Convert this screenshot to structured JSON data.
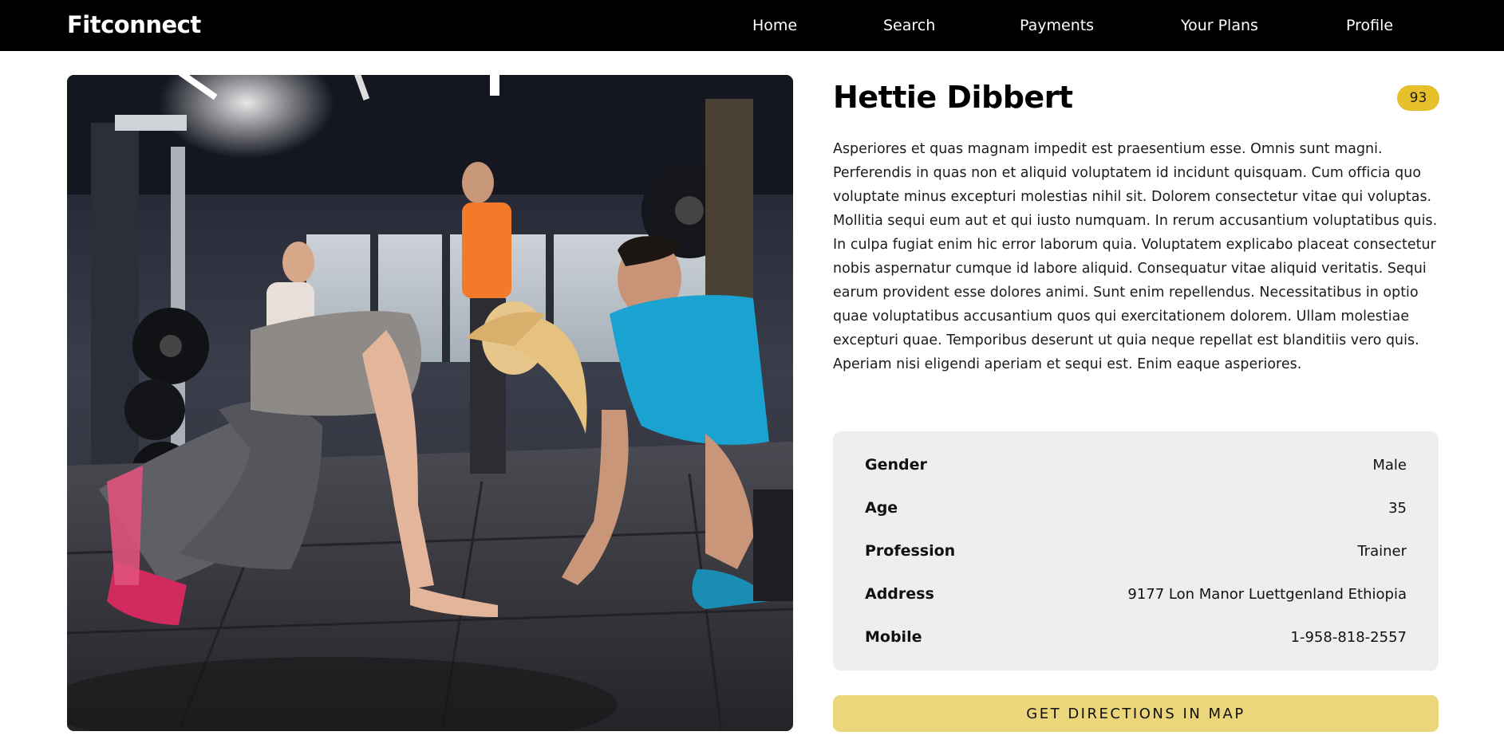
{
  "nav": {
    "brand": "Fitconnect",
    "links": [
      "Home",
      "Search",
      "Payments",
      "Your Plans",
      "Profile"
    ]
  },
  "profile": {
    "name": "Hettie Dibbert",
    "score": "93",
    "bio": "Asperiores et quas magnam impedit est praesentium esse. Omnis sunt magni. Perferendis in quas non et aliquid voluptatem id incidunt quisquam. Cum officia quo voluptate minus excepturi molestias nihil sit. Dolorem consectetur vitae qui voluptas. Mollitia sequi eum aut et qui iusto numquam. In rerum accusantium voluptatibus quis. In culpa fugiat enim hic error laborum quia. Voluptatem explicabo placeat consectetur nobis aspernatur cumque id labore aliquid. Consequatur vitae aliquid veritatis. Sequi earum provident esse dolores animi. Sunt enim repellendus. Necessitatibus in optio quae voluptatibus accusantium quos qui exercitationem dolorem. Ullam molestiae excepturi quae. Temporibus deserunt ut quia neque repellat est blanditiis vero quis. Aperiam nisi eligendi aperiam et sequi est. Enim eaque asperiores.",
    "details": [
      {
        "label": "Gender",
        "value": "Male"
      },
      {
        "label": "Age",
        "value": "35"
      },
      {
        "label": "Profession",
        "value": "Trainer"
      },
      {
        "label": "Address",
        "value": "9177 Lon Manor Luettgenland Ethiopia"
      },
      {
        "label": "Mobile",
        "value": "1-958-818-2557"
      }
    ],
    "directions_button": "GET DIRECTIONS IN MAP"
  },
  "colors": {
    "navbar": "#000000",
    "badge": "#e5c02b",
    "button": "#ecd67c",
    "card": "#eeeeee"
  }
}
